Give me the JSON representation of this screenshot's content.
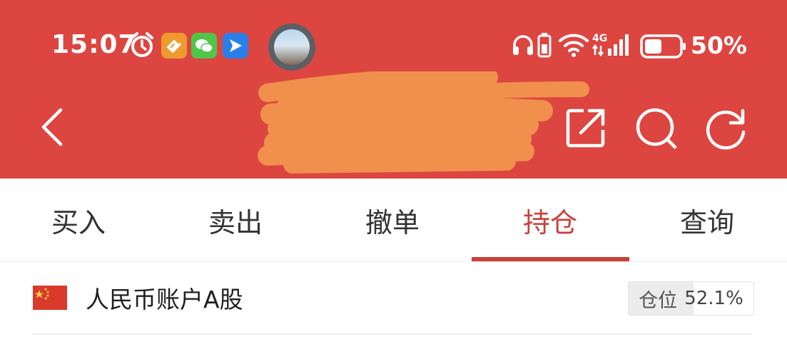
{
  "status_bar": {
    "time": "15:07",
    "battery_percent": "50%",
    "icons": [
      "alarm-icon",
      "app-icon-orange",
      "wechat-icon",
      "app-icon-blue",
      "profile-avatar",
      "headphones-icon",
      "battery-saver-icon",
      "wifi-icon",
      "4g-signal-icon",
      "battery-icon"
    ]
  },
  "header": {
    "title_redacted": true,
    "icons": [
      "back-icon",
      "share-icon",
      "search-icon",
      "refresh-icon"
    ]
  },
  "tabs": [
    {
      "label": "买入",
      "active": false
    },
    {
      "label": "卖出",
      "active": false
    },
    {
      "label": "撤单",
      "active": false
    },
    {
      "label": "持仓",
      "active": true
    },
    {
      "label": "查询",
      "active": false
    }
  ],
  "account": {
    "label": "人民币账户A股",
    "position_key": "仓位",
    "position_value": "52.1%",
    "position_fraction": 0.521
  },
  "colors": {
    "header_red": "#dd4540",
    "accent_red": "#c8413b",
    "redaction": "#f0904c"
  }
}
